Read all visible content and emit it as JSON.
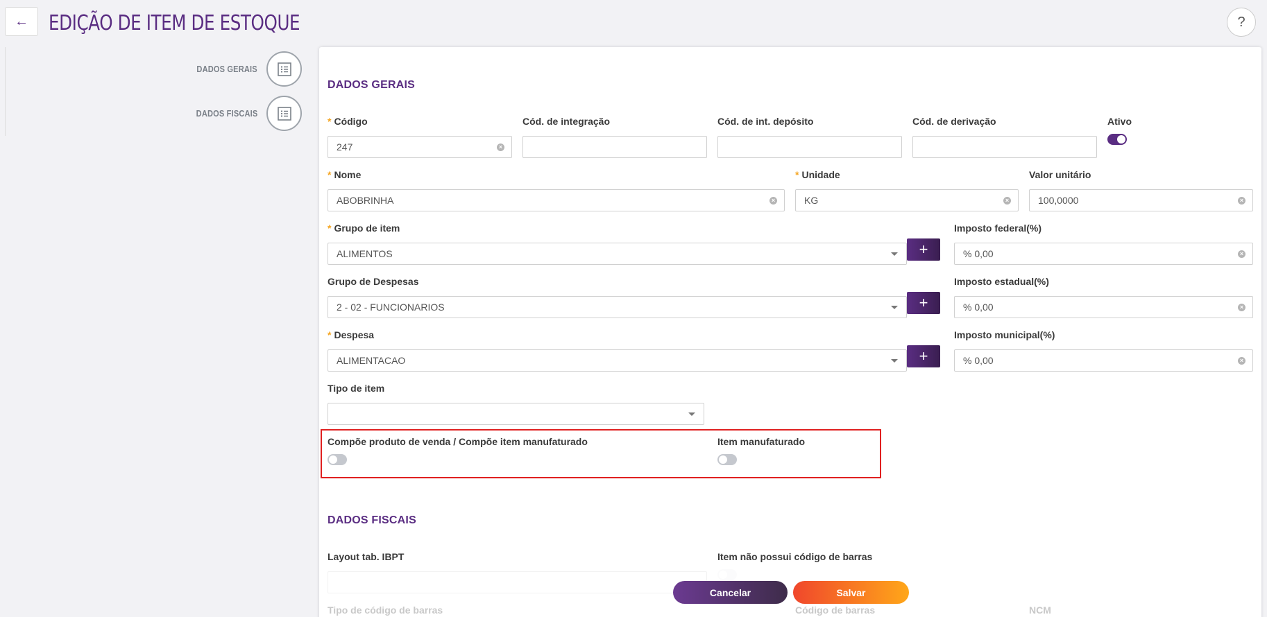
{
  "header": {
    "title": "EDIÇÃO DE ITEM DE ESTOQUE",
    "back_icon": "←",
    "help_icon": "?"
  },
  "nav": {
    "items": [
      {
        "label": "DADOS GERAIS",
        "icon": "list-icon"
      },
      {
        "label": "DADOS FISCAIS",
        "icon": "list-icon"
      }
    ]
  },
  "dados_gerais": {
    "title": "DADOS GERAIS",
    "codigo": {
      "label": "Código",
      "value": "247"
    },
    "cod_integracao": {
      "label": "Cód. de integração",
      "value": ""
    },
    "cod_int_deposito": {
      "label": "Cód. de int. depósito",
      "value": ""
    },
    "cod_derivacao": {
      "label": "Cód. de derivação",
      "value": ""
    },
    "ativo": {
      "label": "Ativo",
      "state": true
    },
    "nome": {
      "label": "Nome",
      "value": "ABOBRINHA"
    },
    "unidade": {
      "label": "Unidade",
      "value": "KG"
    },
    "valor_unitario": {
      "label": "Valor unitário",
      "value": "100,0000"
    },
    "grupo_item": {
      "label": "Grupo de item",
      "value": "ALIMENTOS"
    },
    "imposto_federal": {
      "label": "Imposto federal(%)",
      "value": "% 0,00"
    },
    "grupo_despesas": {
      "label": "Grupo de Despesas",
      "value": "2 - 02 - FUNCIONARIOS"
    },
    "imposto_estadual": {
      "label": "Imposto estadual(%)",
      "value": "% 0,00"
    },
    "despesa": {
      "label": "Despesa",
      "value": "ALIMENTACAO"
    },
    "imposto_municipal": {
      "label": "Imposto municipal(%)",
      "value": "% 0,00"
    },
    "tipo_item": {
      "label": "Tipo de item",
      "value": ""
    },
    "compoe_produto": {
      "label": "Compõe produto de venda / Compõe item manufaturado",
      "state": false
    },
    "item_manufaturado": {
      "label": "Item manufaturado",
      "state": false
    },
    "plus_symbol": "+",
    "clear_symbol": "×",
    "required_mark": "*"
  },
  "dados_fiscais": {
    "title": "DADOS FISCAIS",
    "layout_ibpt": {
      "label": "Layout tab. IBPT",
      "value": ""
    },
    "sem_codigo_barras": {
      "label": "Item não possui código de barras",
      "state": false
    },
    "tipo_codigo_barras": {
      "label": "Tipo de código de barras"
    },
    "codigo_barras": {
      "label": "Código de barras"
    },
    "ncm": {
      "label": "NCM"
    }
  },
  "actions": {
    "cancel": "Cancelar",
    "save": "Salvar"
  },
  "colors": {
    "brand": "#5a2d82",
    "save_start": "#f0472c",
    "save_end": "#ffa719",
    "required": "#f5a623",
    "highlight": "#e02020"
  }
}
